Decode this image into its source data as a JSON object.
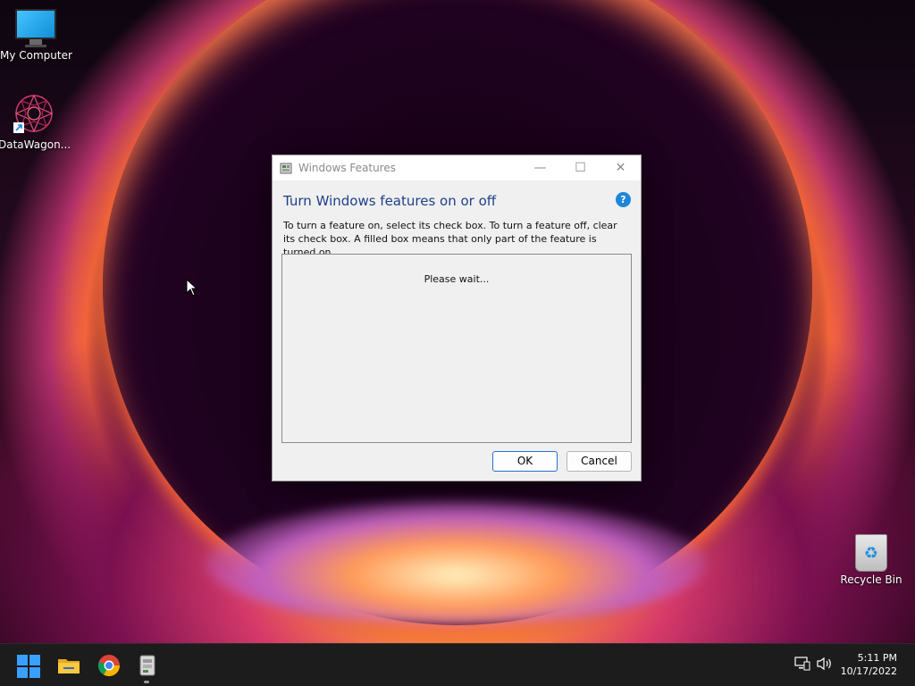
{
  "desktop": {
    "icons": [
      {
        "label": "My Computer",
        "icon": "monitor-icon"
      },
      {
        "label": "DataWagon...",
        "icon": "datawagon-icon"
      },
      {
        "label": "Recycle Bin",
        "icon": "recycle-bin-icon"
      }
    ]
  },
  "dialog": {
    "title": "Windows Features",
    "heading": "Turn Windows features on or off",
    "help_label": "?",
    "description": "To turn a feature on, select its check box. To turn a feature off, clear its check box. A filled box means that only part of the feature is turned on.",
    "status": "Please wait...",
    "ok_label": "OK",
    "cancel_label": "Cancel",
    "minimize_glyph": "—",
    "maximize_glyph": "☐",
    "close_glyph": "✕"
  },
  "taskbar": {
    "apps": [
      "windows-start-icon",
      "file-explorer-icon",
      "chrome-icon",
      "windows-features-icon"
    ],
    "time": "5:11 PM",
    "date": "10/17/2022"
  },
  "colors": {
    "accent": "#2b6ed6",
    "heading": "#1e3f8a",
    "help": "#1e86d8",
    "taskbar": "#1c1c1c"
  }
}
